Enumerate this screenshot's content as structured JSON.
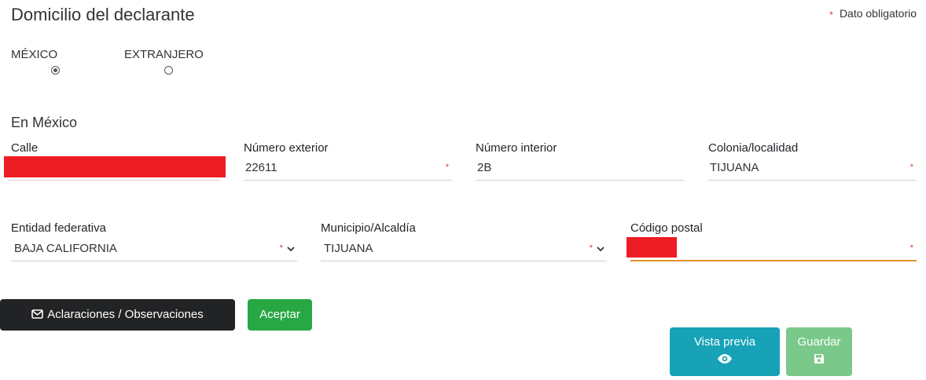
{
  "header": {
    "title": "Domicilio del declarante",
    "required_star": "*",
    "required_note": "Dato obligatorio"
  },
  "location": {
    "options": [
      {
        "label": "MÉXICO",
        "checked": true
      },
      {
        "label": "EXTRANJERO",
        "checked": false
      }
    ]
  },
  "section": {
    "title": "En México"
  },
  "fields": {
    "calle": {
      "label": "Calle",
      "value": ""
    },
    "numero_exterior": {
      "label": "Número exterior",
      "value": "22611",
      "required": "*"
    },
    "numero_interior": {
      "label": "Número interior",
      "value": "2B"
    },
    "colonia": {
      "label": "Colonia/localidad",
      "value": "TIJUANA",
      "required": "*"
    },
    "entidad": {
      "label": "Entidad federativa",
      "value": "BAJA CALIFORNIA",
      "required": "*"
    },
    "municipio": {
      "label": "Municipio/Alcaldía",
      "value": "TIJUANA",
      "required": "*"
    },
    "codigo_postal": {
      "label": "Código postal",
      "value": "",
      "required": "*"
    }
  },
  "buttons": {
    "aclaraciones": "Aclaraciones / Observaciones",
    "aceptar": "Aceptar",
    "vista_previa": "Vista previa",
    "guardar": "Guardar"
  },
  "colors": {
    "required": "#e3342f",
    "dark_button": "#222325",
    "success": "#28a745",
    "info": "#17a2b8",
    "success_light": "#7bc98a",
    "focus_border": "#e0912d",
    "redaction": "#ee1c25"
  }
}
